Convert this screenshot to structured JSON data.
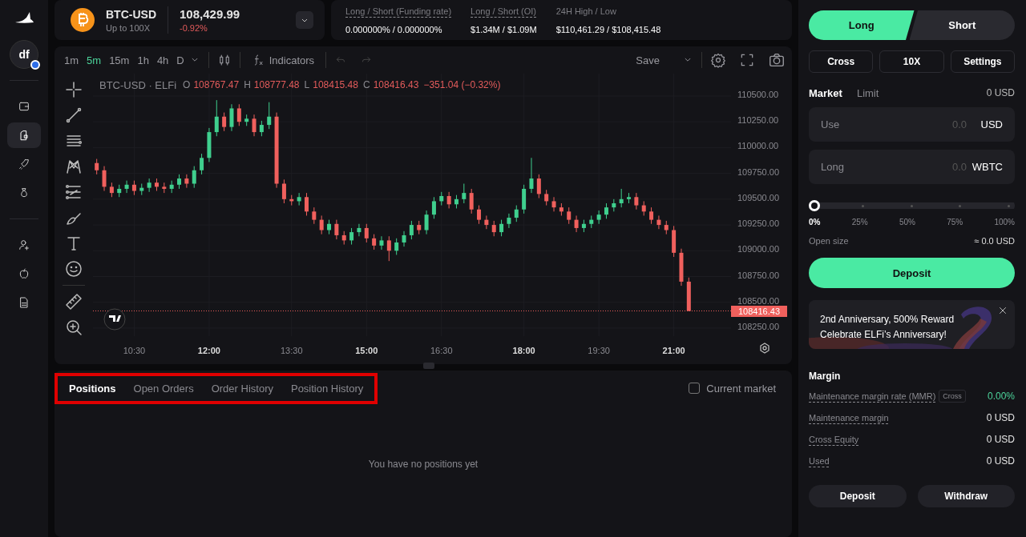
{
  "sidebar": {
    "avatar": "df",
    "items": [
      {
        "selected": false
      },
      {
        "selected": true
      },
      {
        "selected": false
      },
      {
        "selected": false
      },
      {
        "selected": false
      },
      {
        "selected": false
      },
      {
        "selected": false
      }
    ]
  },
  "market": {
    "symbol": "BTC-USD",
    "leverage": "Up to 100X",
    "price": "108,429.99",
    "change": "-0.92%"
  },
  "stats": [
    {
      "label": "Long / Short (Funding rate)",
      "value": "0.000000% / 0.000000%",
      "underlined": true
    },
    {
      "label": "Long / Short (OI)",
      "value": "$1.34M / $1.09M",
      "underlined": true
    },
    {
      "label": "24H High / Low",
      "value": "$110,461.29 / $108,415.48",
      "underlined": false
    }
  ],
  "chart": {
    "intervals": [
      {
        "label": "1m",
        "selected": false
      },
      {
        "label": "5m",
        "selected": true
      },
      {
        "label": "15m",
        "selected": false
      },
      {
        "label": "1h",
        "selected": false
      },
      {
        "label": "4h",
        "selected": false
      },
      {
        "label": "D",
        "selected": false
      }
    ],
    "indicators": "Indicators",
    "save": "Save",
    "title": "BTC-USD · ELFi",
    "ohlc": [
      {
        "key": "O",
        "value": "108767.47"
      },
      {
        "key": "H",
        "value": "108777.48"
      },
      {
        "key": "L",
        "value": "108415.48"
      },
      {
        "key": "C",
        "value": "108416.43"
      }
    ],
    "change": "−351.04 (−0.32%)",
    "last_price": "108416.43",
    "chart_data": {
      "type": "candlestick",
      "categories": [
        null,
        null,
        null,
        null,
        null,
        "10:30",
        null,
        null,
        null,
        null,
        null,
        null,
        null,
        null,
        null,
        "12:00",
        null,
        null,
        null,
        null,
        null,
        null,
        null,
        null,
        null,
        null,
        "13:30",
        null,
        null,
        null,
        null,
        null,
        null,
        null,
        null,
        null,
        "15:00",
        null,
        null,
        null,
        null,
        null,
        null,
        null,
        null,
        null,
        "16:30",
        null,
        null,
        null,
        null,
        null,
        null,
        null,
        null,
        null,
        null,
        "18:00",
        null,
        null,
        null,
        null,
        null,
        null,
        null,
        null,
        null,
        "19:30",
        null,
        null,
        null,
        null,
        null,
        null,
        null,
        null,
        null,
        "21:00",
        null,
        null
      ],
      "ohlc": [
        [
          109850,
          109890,
          109740,
          109780
        ],
        [
          109780,
          109820,
          109580,
          109620
        ],
        [
          109620,
          109660,
          109520,
          109560
        ],
        [
          109560,
          109640,
          109520,
          109600
        ],
        [
          109600,
          109680,
          109560,
          109640
        ],
        [
          109640,
          109680,
          109540,
          109580
        ],
        [
          109580,
          109650,
          109540,
          109610
        ],
        [
          109610,
          109700,
          109570,
          109660
        ],
        [
          109660,
          109700,
          109580,
          109620
        ],
        [
          109620,
          109660,
          109560,
          109600
        ],
        [
          109600,
          109680,
          109560,
          109640
        ],
        [
          109640,
          109740,
          109600,
          109700
        ],
        [
          109700,
          109740,
          109610,
          109650
        ],
        [
          109650,
          109820,
          109610,
          109780
        ],
        [
          109780,
          109940,
          109740,
          109900
        ],
        [
          109900,
          110190,
          109860,
          110150
        ],
        [
          110150,
          110460,
          110110,
          110300
        ],
        [
          110300,
          110340,
          110160,
          110200
        ],
        [
          110200,
          110420,
          110160,
          110380
        ],
        [
          110380,
          110420,
          110210,
          110250
        ],
        [
          110250,
          110320,
          110210,
          110280
        ],
        [
          110280,
          110320,
          110110,
          110150
        ],
        [
          110150,
          110260,
          110110,
          110220
        ],
        [
          110220,
          110440,
          110180,
          110300
        ],
        [
          110300,
          110340,
          109610,
          109650
        ],
        [
          109650,
          109690,
          109460,
          109500
        ],
        [
          109500,
          109540,
          109440,
          109480
        ],
        [
          109480,
          109560,
          109440,
          109520
        ],
        [
          109520,
          109560,
          109340,
          109380
        ],
        [
          109380,
          109420,
          109260,
          109300
        ],
        [
          109300,
          109340,
          109160,
          109200
        ],
        [
          109200,
          109300,
          109160,
          109260
        ],
        [
          109260,
          109300,
          109110,
          109150
        ],
        [
          109150,
          109190,
          109060,
          109100
        ],
        [
          109100,
          109220,
          109060,
          109180
        ],
        [
          109180,
          109260,
          109140,
          109220
        ],
        [
          109220,
          109260,
          109080,
          109120
        ],
        [
          109120,
          109160,
          109010,
          109050
        ],
        [
          109050,
          109140,
          109010,
          109100
        ],
        [
          109100,
          109140,
          108900,
          109000
        ],
        [
          109000,
          109120,
          108960,
          109080
        ],
        [
          109080,
          109190,
          109040,
          109150
        ],
        [
          109150,
          109290,
          109110,
          109250
        ],
        [
          109250,
          109290,
          109160,
          109200
        ],
        [
          109200,
          109390,
          109160,
          109350
        ],
        [
          109350,
          109520,
          109310,
          109480
        ],
        [
          109480,
          109570,
          109440,
          109530
        ],
        [
          109530,
          109570,
          109410,
          109450
        ],
        [
          109450,
          109540,
          109410,
          109500
        ],
        [
          109500,
          109650,
          109460,
          109560
        ],
        [
          109560,
          109600,
          109360,
          109400
        ],
        [
          109400,
          109440,
          109260,
          109300
        ],
        [
          109300,
          109340,
          109210,
          109250
        ],
        [
          109250,
          109290,
          109140,
          109180
        ],
        [
          109180,
          109300,
          109140,
          109260
        ],
        [
          109260,
          109360,
          109220,
          109320
        ],
        [
          109320,
          109440,
          109280,
          109400
        ],
        [
          109400,
          109640,
          109360,
          109600
        ],
        [
          109600,
          109900,
          109560,
          109700
        ],
        [
          109700,
          109740,
          109510,
          109550
        ],
        [
          109550,
          109590,
          109440,
          109480
        ],
        [
          109480,
          109520,
          109380,
          109420
        ],
        [
          109420,
          109460,
          109340,
          109380
        ],
        [
          109380,
          109420,
          109260,
          109300
        ],
        [
          109300,
          109340,
          109180,
          109220
        ],
        [
          109220,
          109300,
          109180,
          109260
        ],
        [
          109260,
          109340,
          109220,
          109300
        ],
        [
          109300,
          109390,
          109260,
          109350
        ],
        [
          109350,
          109460,
          109310,
          109420
        ],
        [
          109420,
          109500,
          109380,
          109460
        ],
        [
          109460,
          109600,
          109420,
          109500
        ],
        [
          109500,
          109560,
          109460,
          109520
        ],
        [
          109520,
          109560,
          109400,
          109440
        ],
        [
          109440,
          109480,
          109340,
          109380
        ],
        [
          109380,
          109420,
          109260,
          109300
        ],
        [
          109300,
          109340,
          109210,
          109250
        ],
        [
          109250,
          109290,
          109160,
          109200
        ],
        [
          109200,
          109240,
          108940,
          108980
        ],
        [
          108980,
          109020,
          108660,
          108700
        ],
        [
          108700,
          108740,
          108415,
          108416
        ]
      ],
      "ylim": [
        108172,
        110717
      ],
      "yticks": [
        {
          "value": 110500,
          "label": "110500.00"
        },
        {
          "value": 110250,
          "label": "110250.00"
        },
        {
          "value": 110000,
          "label": "110000.00"
        },
        {
          "value": 109750,
          "label": "109750.00"
        },
        {
          "value": 109500,
          "label": "109500.00"
        },
        {
          "value": 109250,
          "label": "109250.00"
        },
        {
          "value": 109000,
          "label": "109000.00"
        },
        {
          "value": 108750,
          "label": "108750.00"
        },
        {
          "value": 108500,
          "label": "108500.00"
        },
        {
          "value": 108250,
          "label": "108250.00"
        }
      ],
      "grid": true,
      "ref_lines": [
        {
          "axis": "y",
          "value": 108416.43,
          "color": "#f0605d"
        }
      ]
    },
    "time_ticks": [
      {
        "major": false
      },
      {
        "major": true
      },
      {
        "major": false
      },
      {
        "major": true
      },
      {
        "major": false
      },
      {
        "major": true
      },
      {
        "major": false
      },
      {
        "major": true
      }
    ]
  },
  "positions": {
    "highlighted": true,
    "tabs": [
      {
        "label": "Positions",
        "selected": true
      },
      {
        "label": "Open Orders",
        "selected": false
      },
      {
        "label": "Order History",
        "selected": false
      },
      {
        "label": "Position History",
        "selected": false
      }
    ],
    "filter": {
      "label": "Current market",
      "checked": false
    },
    "empty": "You have no positions yet"
  },
  "order": {
    "sides": [
      {
        "label": "Long",
        "selected": true
      },
      {
        "label": "Short",
        "selected": false
      }
    ],
    "options": [
      "Cross",
      "10X",
      "Settings"
    ],
    "types": [
      {
        "label": "Market",
        "selected": true
      },
      {
        "label": "Limit",
        "selected": false
      }
    ],
    "balance": "0 USD",
    "fields": [
      {
        "label": "Use",
        "placeholder": "0.0",
        "unit": "USD"
      },
      {
        "label": "Long",
        "placeholder": "0.0",
        "unit": "WBTC"
      }
    ],
    "slider": {
      "level": 0,
      "marks": [
        {
          "label": "0%",
          "selected": true
        },
        {
          "label": "25%",
          "selected": false
        },
        {
          "label": "50%",
          "selected": false
        },
        {
          "label": "75%",
          "selected": false
        },
        {
          "label": "100%",
          "selected": false
        }
      ]
    },
    "open_size": {
      "label": "Open size",
      "value": "≈ 0.0 USD"
    },
    "submit": "Deposit",
    "banner": {
      "lines": [
        "2nd Anniversary, 500% Reward",
        "Celebrate ELFi’s Anniversary!"
      ]
    }
  },
  "margin": {
    "title": "Margin",
    "rows": [
      {
        "label": "Maintenance margin rate (MMR)",
        "badge": "Cross",
        "value": "0.00%",
        "color": "#4cd39a"
      },
      {
        "label": "Maintenance margin",
        "value": "0 USD",
        "color": "#e6e6e6"
      },
      {
        "label": "Cross Equity",
        "value": "0 USD",
        "color": "#e6e6e6"
      },
      {
        "label": "Used",
        "value": "0 USD",
        "color": "#e6e6e6"
      }
    ],
    "buttons": [
      "Deposit",
      "Withdraw"
    ]
  }
}
